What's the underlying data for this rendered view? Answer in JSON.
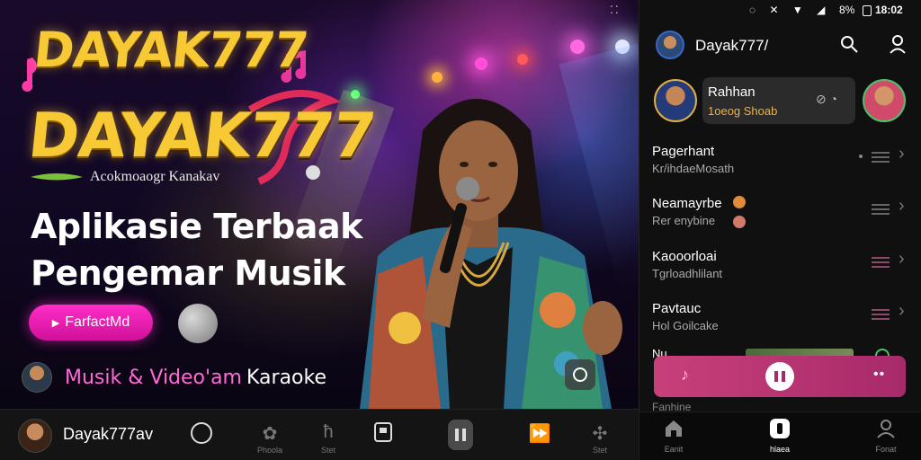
{
  "promo": {
    "logo_top": "DAYAK777",
    "logo_main": "DAYAK777",
    "logo_tagline": "Acokmoaogr Kanakav",
    "headline_line1": "Aplikasie Terbaak",
    "headline_line2": "Pengemar Musik",
    "cta_label": "FarfactMd",
    "musik_video_label": "Musik & Video'am",
    "karaoke_label": "Karaoke"
  },
  "player_bar": {
    "user_name": "Dayak777av",
    "labels": [
      "Phoola",
      "Stet",
      "Stet"
    ]
  },
  "status_bar": {
    "battery": "8%",
    "time": "18:02"
  },
  "app": {
    "header_title": "Dayak777/",
    "story": {
      "title": "Rahhan",
      "subtitle": "1oeog Shoab"
    },
    "list": [
      {
        "title": "Pagerhant",
        "subtitle": "Kr/ihdaeMosath"
      },
      {
        "title": "Neamayrbe",
        "subtitle": "Rer enybine"
      },
      {
        "title": "Kaooorloai",
        "subtitle": "Tgrloadhlilant"
      },
      {
        "title": "Pavtauc",
        "subtitle": "Hol Goilcake"
      }
    ],
    "peek_title": "Nu",
    "below_mini": "Fanhine",
    "nav": [
      {
        "label": "Eanit"
      },
      {
        "label": "hlaea"
      },
      {
        "label": "Fonat"
      }
    ]
  },
  "colors": {
    "accent_pink": "#ff2ec8",
    "logo_gold": "#f7c935",
    "mini_player": "#c8407a"
  }
}
